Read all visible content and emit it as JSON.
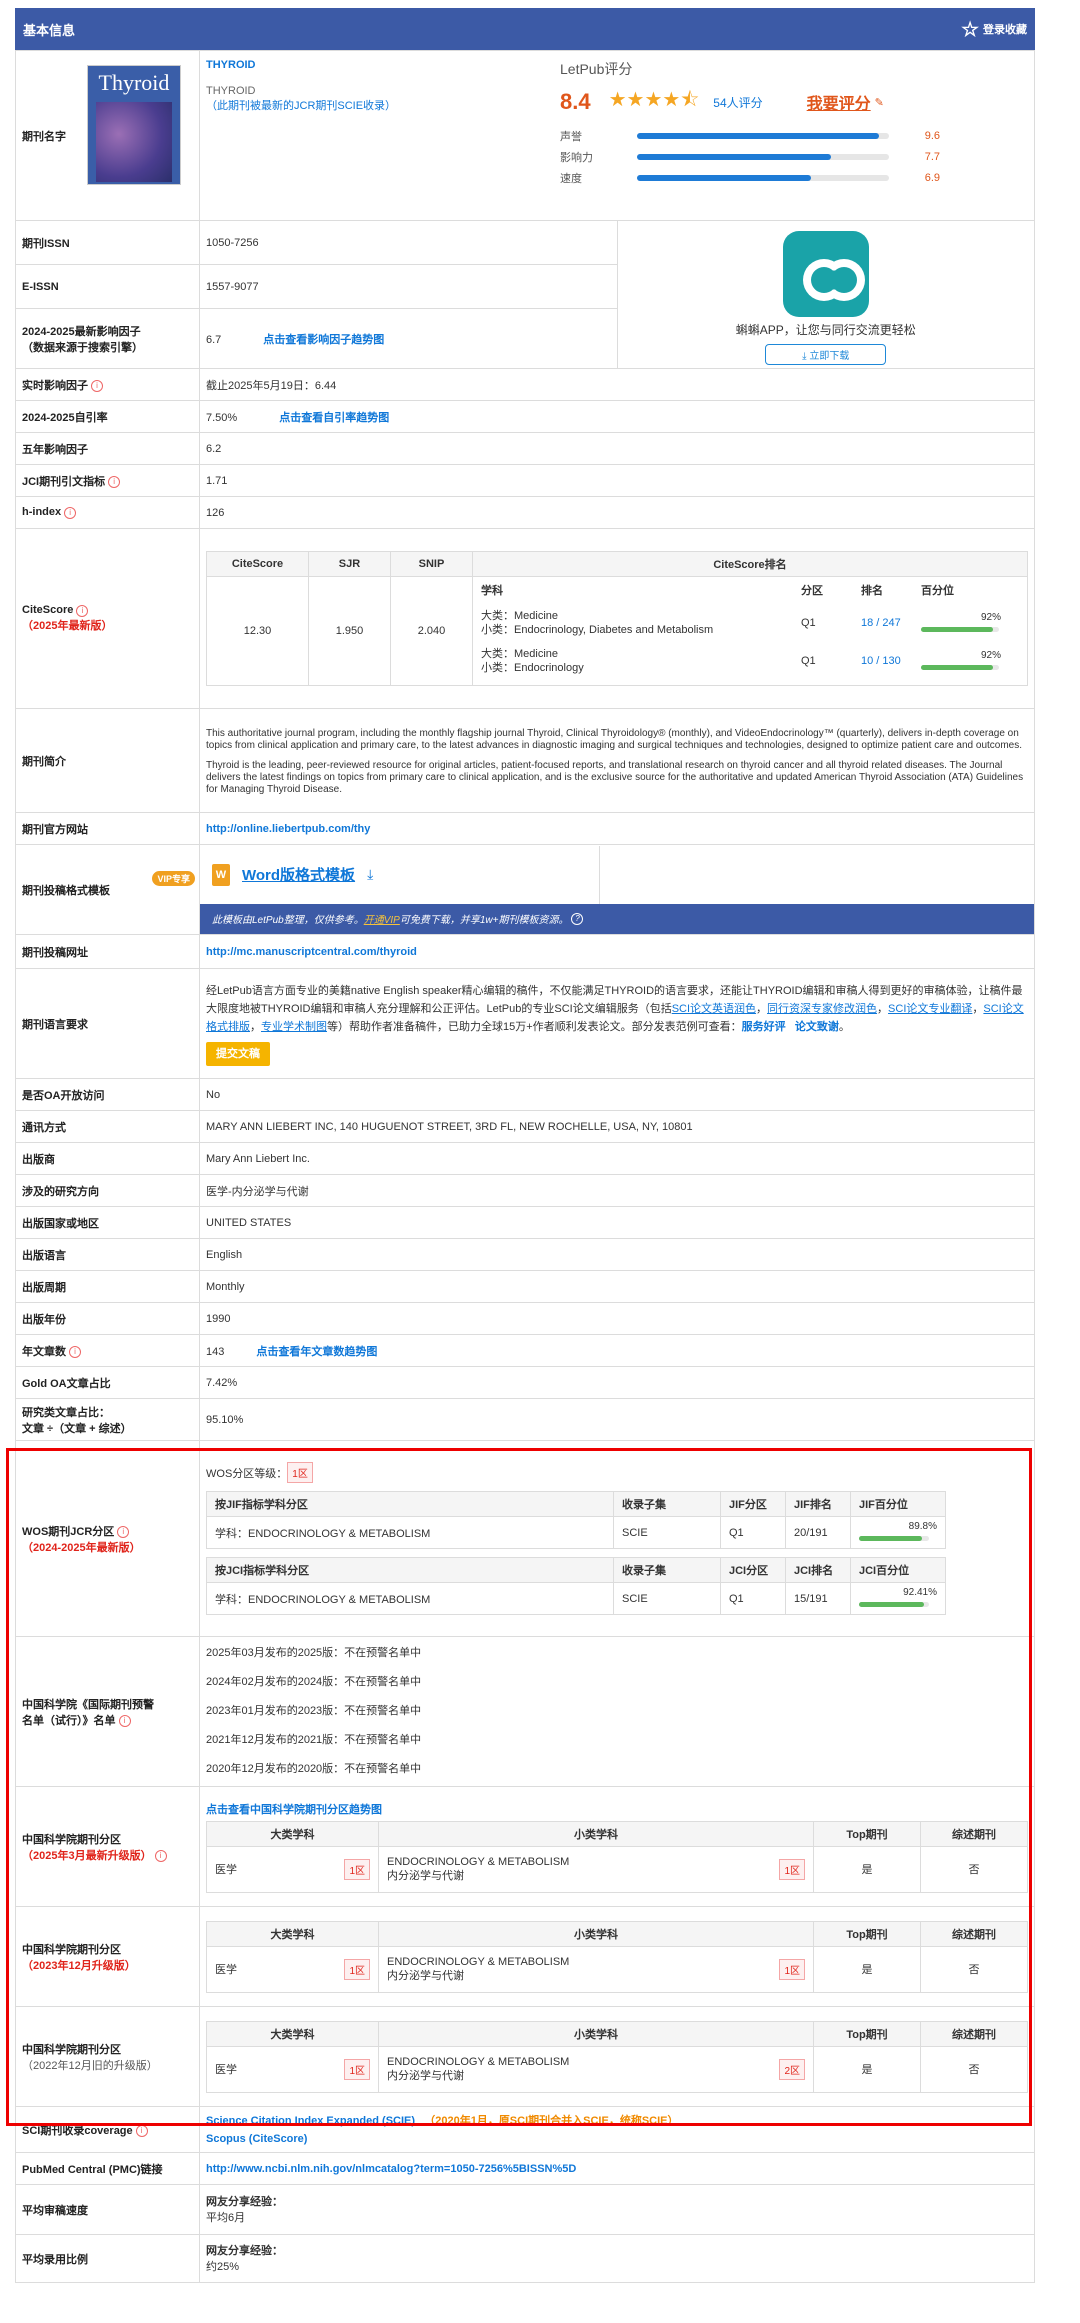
{
  "header": {
    "title": "基本信息",
    "login_save": "登录收藏"
  },
  "journal": {
    "label": "期刊名字",
    "name_link": "THYROID",
    "name": "THYROID",
    "jcr_note": "（此期刊被最新的JCR期刊SCIE收录）",
    "cover_title": "Thyroid"
  },
  "letpub": {
    "title": "LetPub评分",
    "score": "8.4",
    "count": "54人评分",
    "rate_btn": "我要评分",
    "bars": [
      {
        "label": "声誉",
        "value": "9.6",
        "fill": 0.96
      },
      {
        "label": "影响力",
        "value": "7.7",
        "fill": 0.77
      },
      {
        "label": "速度",
        "value": "6.9",
        "fill": 0.69
      }
    ]
  },
  "app": {
    "text": "蝌蝌APP，让您与同行交流更轻松",
    "btn": "立即下载"
  },
  "rows": {
    "issn_l": "期刊ISSN",
    "issn": "1050-7256",
    "eissn_l": "E-ISSN",
    "eissn": "1557-9077",
    "if_l1": "2024-2025最新影响因子",
    "if_l2": "（数据来源于搜索引擎）",
    "if": "6.7",
    "if_link": "点击查看影响因子趋势图",
    "rt_l": "实时影响因子",
    "rt": "截止2025年5月19日：6.44",
    "self_l": "2024-2025自引率",
    "self": "7.50%",
    "self_link": "点击查看自引率趋势图",
    "five_l": "五年影响因子",
    "five": "6.2",
    "jci_l": "JCI期刊引文指标",
    "jci": "1.71",
    "h_l": "h-index",
    "h": "126",
    "cs_l": "CiteScore",
    "cs_sub": "2025年最新版"
  },
  "citescore": {
    "headers": [
      "CiteScore",
      "SJR",
      "SNIP",
      "CiteScore排名"
    ],
    "sub_headers": [
      "学科",
      "分区",
      "排名",
      "百分位"
    ],
    "values": [
      "12.30",
      "1.950",
      "2.040"
    ],
    "ranks": [
      {
        "big": "大类：Medicine",
        "small": "小类：Endocrinology, Diabetes and Metabolism",
        "zone": "Q1",
        "rank": "18 / 247",
        "pct": "92%",
        "fill": 0.92
      },
      {
        "big": "大类：Medicine",
        "small": "小类：Endocrinology",
        "zone": "Q1",
        "rank": "10 / 130",
        "pct": "92%",
        "fill": 0.92
      }
    ]
  },
  "intro": {
    "label": "期刊简介",
    "p1": "This authoritative journal program, including the monthly flagship journal Thyroid, Clinical Thyroidology® (monthly), and VideoEndocrinology™ (quarterly), delivers in-depth coverage on topics from clinical application and primary care, to the latest advances in diagnostic imaging and surgical techniques and technologies, designed to optimize patient care and outcomes.",
    "p2": "Thyroid is the leading, peer-reviewed resource for original articles, patient-focused reports, and translational research on thyroid cancer and all thyroid related diseases. The Journal delivers the latest findings on topics from primary care to clinical application, and is the exclusive source for the authoritative and updated American Thyroid Association (ATA) Guidelines for Managing Thyroid Disease."
  },
  "site": {
    "label": "期刊官方网站",
    "url": "http://online.liebertpub.com/thy"
  },
  "template": {
    "label": "期刊投稿格式模板",
    "vip": "VIP专享",
    "word": "Word版格式模板",
    "note_a": "此模板由LetPub整理，仅供参考。",
    "note_link": "开通VIP",
    "note_b": "可免费下载，并享1w+期刊模板资源。"
  },
  "submit": {
    "label": "期刊投稿网址",
    "url": "http://mc.manuscriptcentral.com/thyroid"
  },
  "lang": {
    "label": "期刊语言要求",
    "t1": "经LetPub语言方面专业的美籍native English speaker精心编辑的稿件，不仅能满足THYROID的语言要求，还能让THYROID编辑和审稿人得到更好的审稿体验，让稿件最大限度地被THYROID编辑和审稿人充分理解和公正评估。LetPub的专业SCI论文编辑服务（包括",
    "l1": "SCI论文英语润色",
    "l2": "同行资深专家修改润色",
    "l3": "SCI论文专业翻译",
    "l4": "SCI论文格式排版",
    "l5": "专业学术制图",
    "t2": "等）帮助作者准备稿件，已助力全球15万+作者顺利发表论文。部分发表范例可查看：",
    "l6": "服务好评",
    "l7": "论文致谢",
    "btn": "提交文稿"
  },
  "simple_rows": [
    {
      "label": "是否OA开放访问",
      "value": "No"
    },
    {
      "label": "通讯方式",
      "value": "MARY ANN LIEBERT INC, 140 HUGUENOT STREET, 3RD FL, NEW ROCHELLE, USA, NY, 10801"
    },
    {
      "label": "出版商",
      "value": "Mary Ann Liebert Inc."
    },
    {
      "label": "涉及的研究方向",
      "value": "医学-内分泌学与代谢"
    },
    {
      "label": "出版国家或地区",
      "value": "UNITED STATES"
    },
    {
      "label": "出版语言",
      "value": "English"
    },
    {
      "label": "出版周期",
      "value": "Monthly"
    },
    {
      "label": "出版年份",
      "value": "1990"
    }
  ],
  "articles": {
    "label": "年文章数",
    "value": "143",
    "link": "点击查看年文章数趋势图"
  },
  "gold": {
    "label": "Gold OA文章占比",
    "value": "7.42%"
  },
  "research": {
    "l1": "研究类文章占比：",
    "l2": "文章 ÷（文章 + 综述）",
    "value": "95.10%"
  },
  "wos": {
    "l1": "WOS期刊JCR分区",
    "l2": "2024-2025年最新版",
    "grade_label": "WOS分区等级：",
    "grade": "1区",
    "jif_headers": [
      "按JIF指标学科分区",
      "收录子集",
      "JIF分区",
      "JIF排名",
      "JIF百分位"
    ],
    "jif_row": [
      "学科：ENDOCRINOLOGY & METABOLISM",
      "SCIE",
      "Q1",
      "20/191",
      "89.8%"
    ],
    "jif_fill": 0.898,
    "jci_headers": [
      "按JCI指标学科分区",
      "收录子集",
      "JCI分区",
      "JCI排名",
      "JCI百分位"
    ],
    "jci_row": [
      "学科：ENDOCRINOLOGY & METABOLISM",
      "SCIE",
      "Q1",
      "15/191",
      "92.41%"
    ],
    "jci_fill": 0.924
  },
  "warn": {
    "l1": "中国科学院《国际期刊预警",
    "l2": "名单（试行）》名单",
    "items": [
      "2025年03月发布的2025版：不在预警名单中",
      "2024年02月发布的2024版：不在预警名单中",
      "2023年01月发布的2023版：不在预警名单中",
      "2021年12月发布的2021版：不在预警名单中",
      "2020年12月发布的2020版：不在预警名单中"
    ]
  },
  "cas": [
    {
      "l1": "中国科学院期刊分区",
      "l2": "2025年3月最新升级版",
      "link": "点击查看中国科学院期刊分区趋势图",
      "big": "医学",
      "bigzone": "1区",
      "small1": "ENDOCRINOLOGY & METABOLISM",
      "small2": "内分泌学与代谢",
      "smallzone": "1区",
      "top": "是",
      "review": "否"
    },
    {
      "l1": "中国科学院期刊分区",
      "l2": "2023年12月升级版",
      "big": "医学",
      "bigzone": "1区",
      "small1": "ENDOCRINOLOGY & METABOLISM",
      "small2": "内分泌学与代谢",
      "smallzone": "1区",
      "top": "是",
      "review": "否"
    },
    {
      "l1": "中国科学院期刊分区",
      "l2": "2022年12月旧的升级版",
      "big": "医学",
      "bigzone": "1区",
      "small1": "ENDOCRINOLOGY & METABOLISM",
      "small2": "内分泌学与代谢",
      "smallzone": "2区",
      "top": "是",
      "review": "否"
    }
  ],
  "cas_headers": [
    "大类学科",
    "小类学科",
    "Top期刊",
    "综述期刊"
  ],
  "coverage": {
    "label": "SCI期刊收录coverage",
    "l1": "Science Citation Index Expanded (SCIE)",
    "note": "（2020年1月，原SCI期刊合并入SCIE，统称SCIE）",
    "l2": "Scopus (CiteScore)"
  },
  "pmc": {
    "label": "PubMed Central (PMC)链接",
    "url": "http://www.ncbi.nlm.nih.gov/nlmcatalog?term=1050-7256%5BISSN%5D"
  },
  "review": {
    "label": "平均审稿速度",
    "h": "网友分享经验：",
    "v": "平均6月"
  },
  "accept": {
    "label": "平均录用比例",
    "h": "网友分享经验：",
    "v": "约25%"
  }
}
